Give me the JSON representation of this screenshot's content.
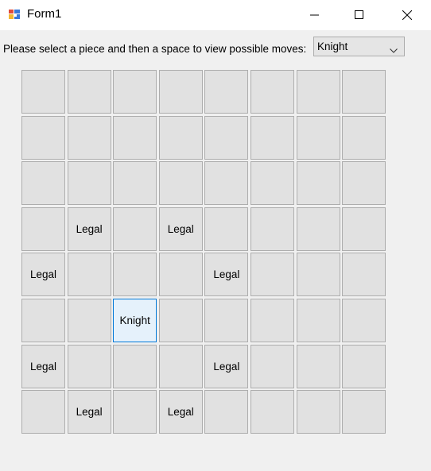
{
  "window": {
    "title": "Form1",
    "controls": [
      "minimize-icon",
      "maximize-icon",
      "close-icon"
    ]
  },
  "prompt": "Please select a piece and then a space to view possible moves:",
  "piece_select": {
    "selected": "Knight"
  },
  "board": {
    "rows": [
      [
        "",
        "",
        "",
        "",
        "",
        "",
        "",
        ""
      ],
      [
        "",
        "",
        "",
        "",
        "",
        "",
        "",
        ""
      ],
      [
        "",
        "",
        "",
        "",
        "",
        "",
        "",
        ""
      ],
      [
        "",
        "Legal",
        "",
        "Legal",
        "",
        "",
        "",
        ""
      ],
      [
        "Legal",
        "",
        "",
        "",
        "Legal",
        "",
        "",
        ""
      ],
      [
        "",
        "",
        "Knight",
        "",
        "",
        "",
        "",
        ""
      ],
      [
        "Legal",
        "",
        "",
        "",
        "Legal",
        "",
        "",
        ""
      ],
      [
        "",
        "Legal",
        "",
        "Legal",
        "",
        "",
        "",
        ""
      ]
    ],
    "selected_cell": "Knight"
  },
  "colors": {
    "cell_bg": "#e1e1e1",
    "cell_border": "#adadad",
    "selected_bg": "#e5f1fb",
    "selected_border": "#0078d7",
    "window_bg": "#f0f0f0"
  }
}
